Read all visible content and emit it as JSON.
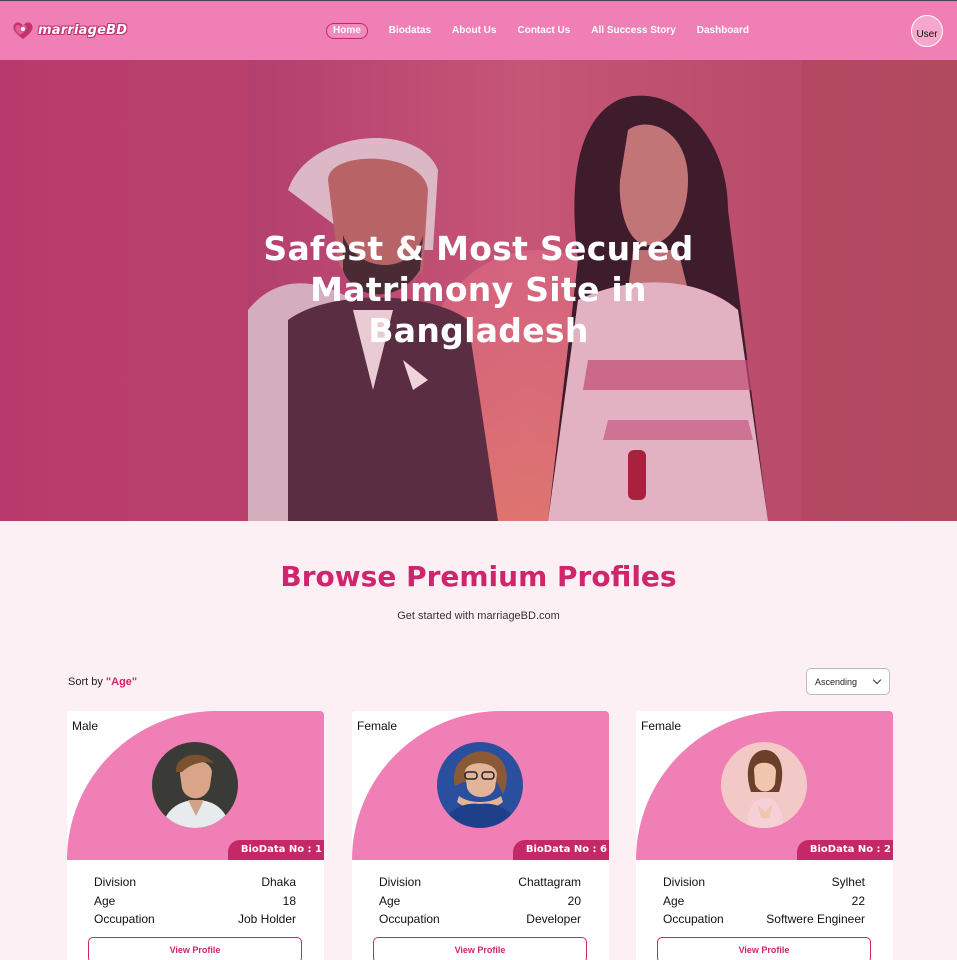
{
  "nav": {
    "brand": "marriageBD",
    "links": [
      "Home",
      "Biodatas",
      "About Us",
      "Contact Us",
      "All Success Story",
      "Dashboard"
    ],
    "avatar_alt": "User"
  },
  "hero": {
    "title_line1": "Safest & Most Secured",
    "title_line2": "Matrimony Site in",
    "title_line3": "Bangladesh"
  },
  "section": {
    "title": "Browse Premium Profiles",
    "subtitle": "Get started with marriageBD.com"
  },
  "sort": {
    "prefix": "Sort by ",
    "key": "\"Age\"",
    "selected": "Ascending"
  },
  "profiles": [
    {
      "gender": "Male",
      "badge": "BioData No : 1",
      "labels": [
        "Division",
        "Age",
        "Occupation"
      ],
      "division": "Dhaka",
      "age": "18",
      "occupation": "Job Holder",
      "button": "View Profile"
    },
    {
      "gender": "Female",
      "badge": "BioData No : 6",
      "labels": [
        "Division",
        "Age",
        "Occupation"
      ],
      "division": "Chattagram",
      "age": "20",
      "occupation": "Developer",
      "button": "View Profile"
    },
    {
      "gender": "Female",
      "badge": "BioData No : 2",
      "labels": [
        "Division",
        "Age",
        "Occupation"
      ],
      "division": "Sylhet",
      "age": "22",
      "occupation": "Softwere Engineer",
      "button": "View Profile"
    }
  ],
  "colors": {
    "navbar": "#ef7fb5",
    "accent": "#d0256c",
    "badge": "#c42866",
    "page_bg": "#fdf0f5"
  }
}
